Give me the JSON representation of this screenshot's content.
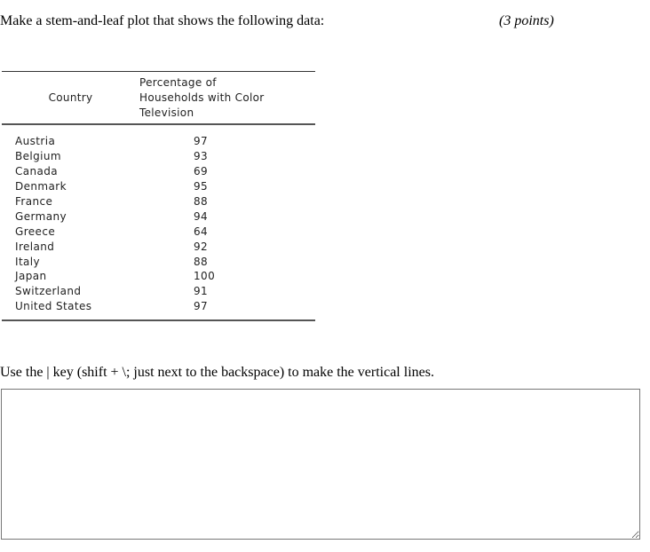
{
  "question": {
    "prompt": "Make a stem-and-leaf plot that shows the following data:",
    "points": "(3 points)",
    "instruction": "Use the | key (shift + \\; just next to the backspace) to make the vertical lines."
  },
  "table": {
    "headers": [
      "Country",
      "Percentage of Households with Color Television"
    ],
    "header_lines": [
      "Percentage of",
      "Households with Color",
      "Television"
    ],
    "rows": [
      {
        "country": "Austria",
        "value": "97"
      },
      {
        "country": "Belgium",
        "value": "93"
      },
      {
        "country": "Canada",
        "value": "69"
      },
      {
        "country": "Denmark",
        "value": "95"
      },
      {
        "country": "France",
        "value": "88"
      },
      {
        "country": "Germany",
        "value": "94"
      },
      {
        "country": "Greece",
        "value": "64"
      },
      {
        "country": "Ireland",
        "value": "92"
      },
      {
        "country": "Italy",
        "value": "88"
      },
      {
        "country": "Japan",
        "value": "100"
      },
      {
        "country": "Switzerland",
        "value": "91"
      },
      {
        "country": "United States",
        "value": "97"
      }
    ]
  },
  "answer": {
    "value": "",
    "placeholder": ""
  }
}
